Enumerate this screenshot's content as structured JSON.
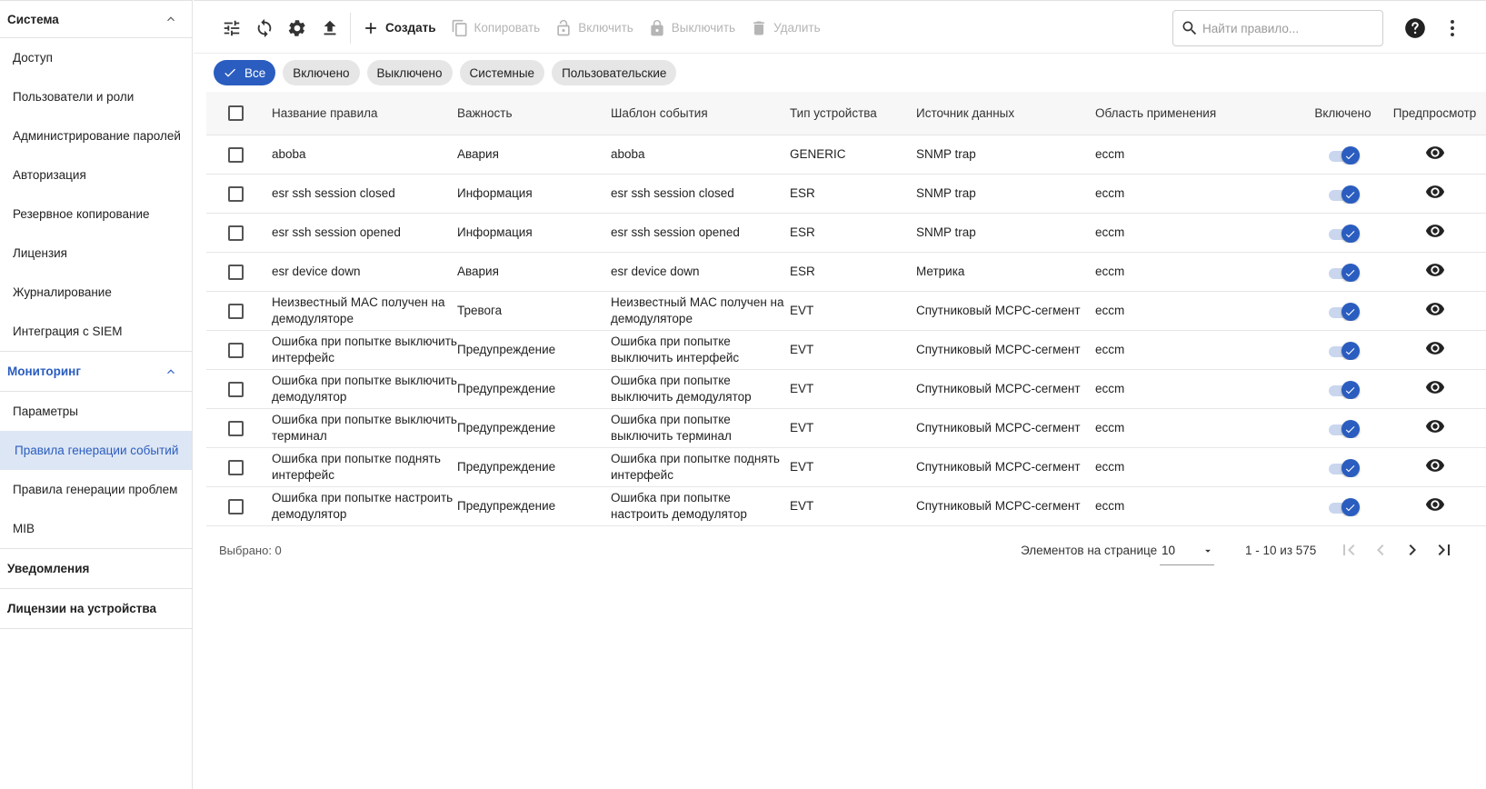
{
  "sidebar": {
    "groups": [
      {
        "label": "Система"
      },
      {
        "label": "Мониторинг"
      },
      {
        "label": "Уведомления"
      },
      {
        "label": "Лицензии на устройства"
      }
    ],
    "system_items": [
      "Доступ",
      "Пользователи и роли",
      "Администрирование паролей",
      "Авторизация",
      "Резервное копирование",
      "Лицензия",
      "Журналирование",
      "Интеграция с SIEM"
    ],
    "monitoring_items": [
      "Параметры",
      "Правила генерации событий",
      "Правила генерации проблем",
      "MIB"
    ],
    "selected_item": "Правила генерации событий"
  },
  "toolbar": {
    "create": "Создать",
    "copy": "Копировать",
    "enable": "Включить",
    "disable": "Выключить",
    "delete": "Удалить",
    "search_placeholder": "Найти правило...",
    "icons": [
      "tune-icon",
      "refresh-icon",
      "settings-icon",
      "upload-icon"
    ]
  },
  "filters": {
    "chips": [
      "Все",
      "Включено",
      "Выключено",
      "Системные",
      "Пользовательские"
    ],
    "active": "Все"
  },
  "table": {
    "headers": [
      "Название правила",
      "Важность",
      "Шаблон события",
      "Тип устройства",
      "Источник данных",
      "Область применения",
      "Включено",
      "Предпросмотр"
    ],
    "rows": [
      {
        "name": "aboba",
        "severity": "Авария",
        "template": "aboba",
        "device": "GENERIC",
        "source": "SNMP trap",
        "scope": "eccm",
        "enabled": true
      },
      {
        "name": "esr ssh session closed",
        "severity": "Информация",
        "template": "esr ssh session closed",
        "device": "ESR",
        "source": "SNMP trap",
        "scope": "eccm",
        "enabled": true
      },
      {
        "name": "esr ssh session opened",
        "severity": "Информация",
        "template": "esr ssh session opened",
        "device": "ESR",
        "source": "SNMP trap",
        "scope": "eccm",
        "enabled": true
      },
      {
        "name": "esr device down",
        "severity": "Авария",
        "template": "esr device down",
        "device": "ESR",
        "source": "Метрика",
        "scope": "eccm",
        "enabled": true
      },
      {
        "name": "Неизвестный MAC получен на демодуляторе",
        "severity": "Тревога",
        "template": "Неизвестный MAC получен на демодуляторе",
        "device": "EVT",
        "source": "Спутниковый MCPC-сегмент",
        "scope": "eccm",
        "enabled": true
      },
      {
        "name": "Ошибка при попытке выключить интерфейс",
        "severity": "Предупреждение",
        "template": "Ошибка при попытке выключить интерфейс",
        "device": "EVT",
        "source": "Спутниковый MCPC-сегмент",
        "scope": "eccm",
        "enabled": true
      },
      {
        "name": "Ошибка при попытке выключить демодулятор",
        "severity": "Предупреждение",
        "template": "Ошибка при попытке выключить демодулятор",
        "device": "EVT",
        "source": "Спутниковый MCPC-сегмент",
        "scope": "eccm",
        "enabled": true
      },
      {
        "name": "Ошибка при попытке выключить терминал",
        "severity": "Предупреждение",
        "template": "Ошибка при попытке выключить терминал",
        "device": "EVT",
        "source": "Спутниковый MCPC-сегмент",
        "scope": "eccm",
        "enabled": true
      },
      {
        "name": "Ошибка при попытке поднять интерфейс",
        "severity": "Предупреждение",
        "template": "Ошибка при попытке поднять интерфейс",
        "device": "EVT",
        "source": "Спутниковый MCPC-сегмент",
        "scope": "eccm",
        "enabled": true
      },
      {
        "name": "Ошибка при попытке настроить демодулятор",
        "severity": "Предупреждение",
        "template": "Ошибка при попытке настроить демодулятор",
        "device": "EVT",
        "source": "Спутниковый MCPC-сегмент",
        "scope": "eccm",
        "enabled": true
      }
    ]
  },
  "footer": {
    "selected": "Выбрано: 0",
    "per_page_label": "Элементов на странице",
    "per_page_value": "10",
    "range": "1 - 10 из 575"
  },
  "colors": {
    "accent": "#2a5dbf",
    "selected_bg": "#dde6f4",
    "chip_bg": "#e6e6e6"
  }
}
